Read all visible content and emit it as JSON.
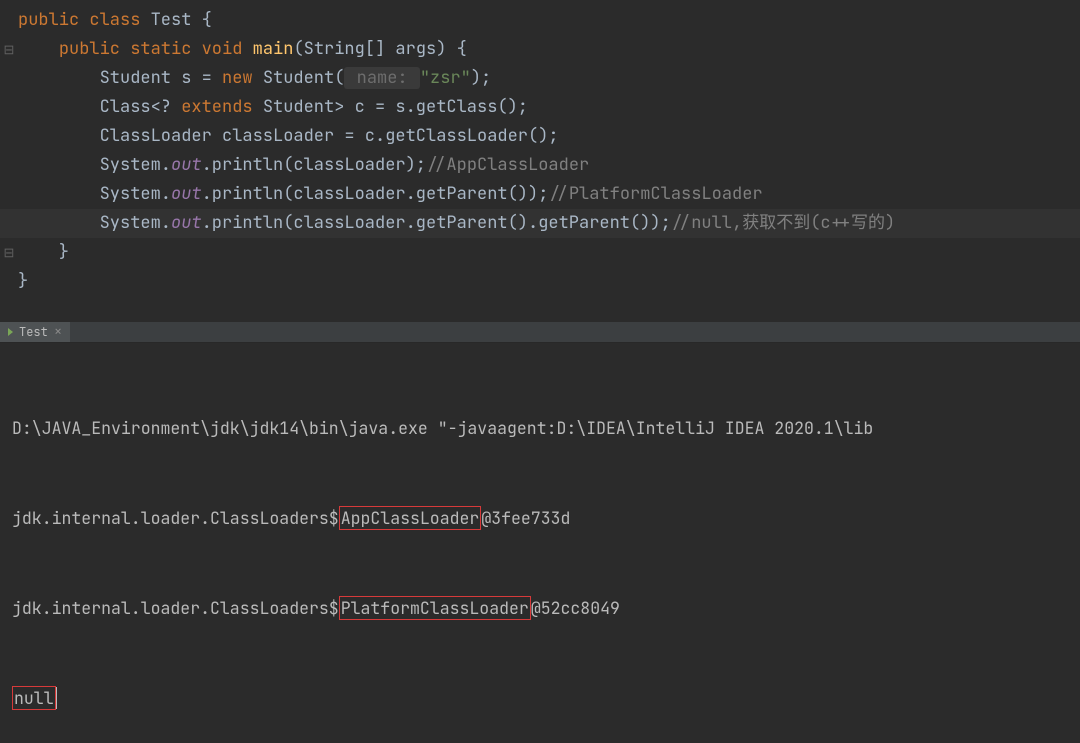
{
  "code": {
    "l1": {
      "g": " ",
      "t1": "public class ",
      "t2": "Test {"
    },
    "l2": {
      "g": "⊟",
      "t1": "    ",
      "t2": "public static void ",
      "t3": "main",
      "t4": "(String[] args) {"
    },
    "l3": {
      "g": " ",
      "t1": "        Student s = ",
      "t2": "new ",
      "t3": "Student(",
      "hint": " name: ",
      "t4": "\"zsr\"",
      "t5": ");"
    },
    "l4": {
      "g": " ",
      "t1": "        Class<? ",
      "t2": "extends ",
      "t3": "Student> c = s.getClass();"
    },
    "l5": {
      "g": " ",
      "t1": "        ClassLoader classLoader = c.getClassLoader();"
    },
    "l6": {
      "g": " ",
      "t1": "        System.",
      "t2": "out",
      "t3": ".println(classLoader);",
      "c": "//AppClassLoader"
    },
    "l7": {
      "g": " ",
      "t1": "        System.",
      "t2": "out",
      "t3": ".println(classLoader.getParent());",
      "c": "//PlatformClassLoader"
    },
    "l8": {
      "g": " ",
      "t1": "        System.",
      "t2": "out",
      "t3": ".println(classLoader.getParent().getParent());",
      "c": "//null,获取不到(c++写的)"
    },
    "l9": {
      "g": "⊟",
      "t1": "    }"
    },
    "l10": {
      "g": " ",
      "t1": "}"
    }
  },
  "tab": {
    "label": "Test",
    "close": "×"
  },
  "console": {
    "cmd": "D:\\JAVA_Environment\\jdk\\jdk14\\bin\\java.exe \"-javaagent:D:\\IDEA\\IntelliJ IDEA 2020.1\\lib",
    "l2a": "jdk.internal.loader.ClassLoaders$",
    "l2b": "AppClassLoader",
    "l2c": "@3fee733d",
    "l3a": "jdk.internal.loader.ClassLoaders$",
    "l3b": "PlatformClassLoader",
    "l3c": "@52cc8049",
    "l4": "null"
  }
}
